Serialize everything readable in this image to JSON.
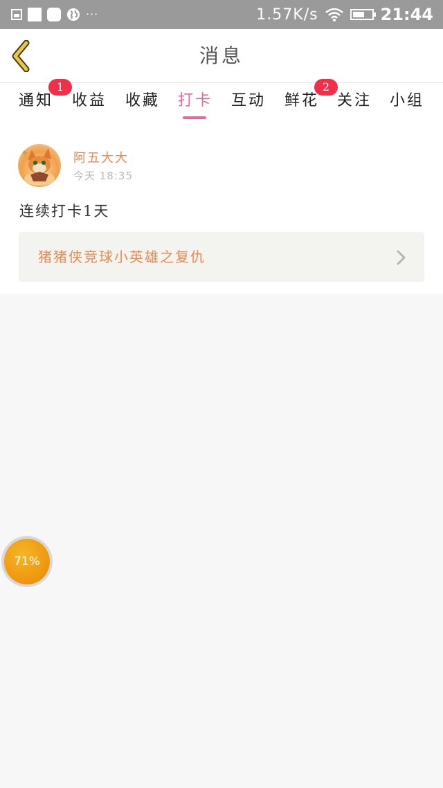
{
  "status_bar": {
    "speed": "1.57K/s",
    "time": "21:44",
    "icons": [
      "image-icon",
      "square-icon",
      "rounded-square-icon",
      "globe-icon",
      "more-dots-icon",
      "wifi-icon",
      "battery-icon"
    ],
    "more": "···"
  },
  "header": {
    "title": "消息",
    "back_icon": "chevron-left-icon"
  },
  "tabs": [
    {
      "label": "通知",
      "badge": "1"
    },
    {
      "label": "收益"
    },
    {
      "label": "收藏"
    },
    {
      "label": "打卡",
      "active": true
    },
    {
      "label": "互动"
    },
    {
      "label": "鲜花",
      "badge": "2"
    },
    {
      "label": "关注"
    },
    {
      "label": "小组"
    }
  ],
  "post": {
    "username": "阿五大大",
    "time": "今天  18:35",
    "text": "连续打卡1天",
    "link_title": "猪猪侠竞球小英雄之复仇"
  },
  "floating_ball": {
    "label": "71%"
  },
  "colors": {
    "accent": "#e06a9c",
    "username": "#e88a52",
    "badge": "#f0304a",
    "back_icon": "#e8c64a"
  }
}
